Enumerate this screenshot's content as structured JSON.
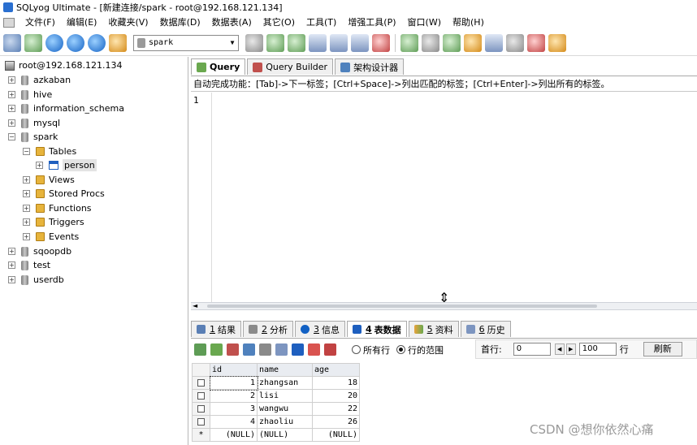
{
  "window": {
    "title": "SQLyog Ultimate - [新建连接/spark - root@192.168.121.134]"
  },
  "menu": [
    "文件(F)",
    "编辑(E)",
    "收藏夹(V)",
    "数据库(D)",
    "数据表(A)",
    "其它(O)",
    "工具(T)",
    "增强工具(P)",
    "窗口(W)",
    "帮助(H)"
  ],
  "toolbar": {
    "database_selector": "spark"
  },
  "tree": {
    "root": "root@192.168.121.134",
    "databases": [
      "azkaban",
      "hive",
      "information_schema",
      "mysql",
      "spark"
    ],
    "spark_children": {
      "tables_label": "Tables",
      "table": "person",
      "views": "Views",
      "procs": "Stored Procs",
      "functions": "Functions",
      "triggers": "Triggers",
      "events": "Events"
    },
    "databases_after": [
      "sqoopdb",
      "test",
      "userdb"
    ]
  },
  "editor_tabs": [
    "Query",
    "Query Builder",
    "架构设计器"
  ],
  "hint": "自动完成功能：[Tab]->下一标签；[Ctrl+Space]->列出匹配的标签；[Ctrl+Enter]->列出所有的标签。",
  "editor": {
    "line": "1"
  },
  "result_tabs": [
    {
      "num": "1",
      "label": "结果"
    },
    {
      "num": "2",
      "label": "分析"
    },
    {
      "num": "3",
      "label": "信息"
    },
    {
      "num": "4",
      "label": "表数据"
    },
    {
      "num": "5",
      "label": "资料"
    },
    {
      "num": "6",
      "label": "历史"
    }
  ],
  "filter": {
    "all_rows": "所有行",
    "range": "行的范围"
  },
  "pager": {
    "label": "首行:",
    "first": "0",
    "count": "100",
    "unit": "行",
    "refresh": "刷新"
  },
  "grid": {
    "columns": [
      "id",
      "name",
      "age"
    ],
    "rows": [
      [
        "1",
        "zhangsan",
        "18"
      ],
      [
        "2",
        "lisi",
        "20"
      ],
      [
        "3",
        "wangwu",
        "22"
      ],
      [
        "4",
        "zhaoliu",
        "26"
      ],
      [
        "(NULL)",
        "(NULL)",
        "(NULL)"
      ]
    ],
    "new_row_marker": "*"
  },
  "watermark": "CSDN @想你依然心痛"
}
